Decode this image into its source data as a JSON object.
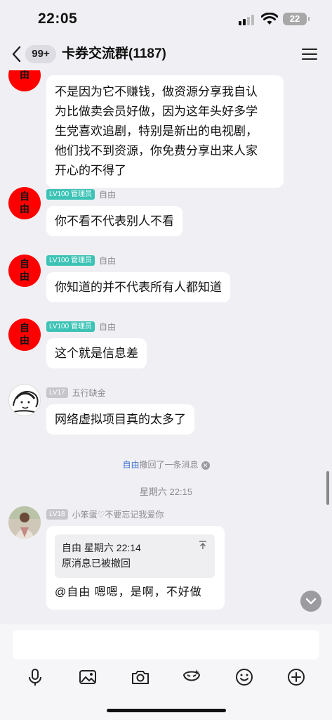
{
  "status_bar": {
    "time": "22:05",
    "battery": "22"
  },
  "nav": {
    "badge": "99+",
    "title": "卡券交流群(1187)"
  },
  "messages": {
    "m1": {
      "avatar_chars": [
        "",
        "由"
      ],
      "text_lines": [
        "不是因为它不赚钱，做资源分享我自认",
        "为比做卖会员好做，因为这年头好多学",
        "生党喜欢追剧，特别是新出的电视剧，",
        "他们找不到资源，你免费分享出来人家",
        "开心的不得了"
      ]
    },
    "m2": {
      "avatar_chars": [
        "自",
        "由"
      ],
      "level": "LV100 管理员",
      "sender": "自由",
      "text": "你不看不代表别人不看"
    },
    "m3": {
      "avatar_chars": [
        "自",
        "由"
      ],
      "level": "LV100 管理员",
      "sender": "自由",
      "text": "你知道的并不代表所有人都知道"
    },
    "m4": {
      "avatar_chars": [
        "自",
        "由"
      ],
      "level": "LV100 管理员",
      "sender": "自由",
      "text": "这个就是信息差"
    },
    "m5": {
      "level": "LV17",
      "sender": "五行缺金",
      "text": "网络虚拟项目真的太多了"
    },
    "m6": {
      "level": "LV18",
      "sender": "小笨蛋♡不要忘记我爱你",
      "quote_header": "自由 星期六 22:14",
      "quote_text": "原消息已被撤回",
      "text": "@自由 嗯嗯，是啊，不好做"
    }
  },
  "system": {
    "recall_name": "自由",
    "recall_text": "撤回了一条消息",
    "timestamp": "星期六 22:15"
  },
  "input": {
    "placeholder": ""
  },
  "toolbar_icons": [
    "microphone-icon",
    "image-icon",
    "camera-icon",
    "red-packet-icon",
    "emoji-icon",
    "plus-icon"
  ]
}
